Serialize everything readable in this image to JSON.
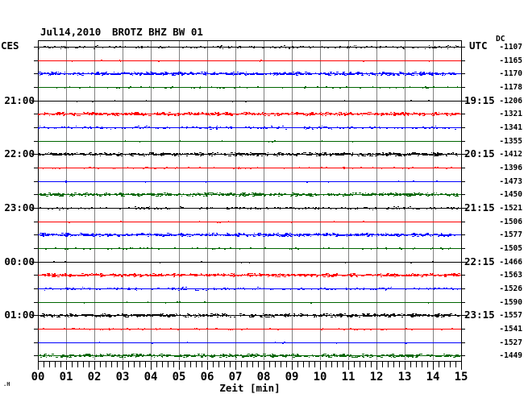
{
  "header": {
    "date": "Jul14,2010",
    "station": "BROTZ BHZ BW 01"
  },
  "watermark": ".H",
  "chart_data": {
    "type": "line",
    "title": "Jul14,2010 BROTZ BHZ BW 01",
    "subtitle": "Helicorder drum plot, 24 rows of 15 minutes each",
    "xlabel": "Zeit [min]",
    "x_min": 0,
    "x_max": 15,
    "x_tick_labels": [
      "00",
      "01",
      "02",
      "03",
      "04",
      "05",
      "06",
      "07",
      "08",
      "09",
      "10",
      "11",
      "12",
      "13",
      "14",
      "15"
    ],
    "x_minor_ticks_per_minute": 5,
    "grid": {
      "vertical_minute_lines": true,
      "horizontal_lines": false
    },
    "legend": "none",
    "rows": 24,
    "row_duration_minutes": 15,
    "trace_color_cycle": [
      "black",
      "red",
      "blue",
      "green"
    ],
    "palette": {
      "black": "#000000",
      "red": "#ff0000",
      "blue": "#0000ff",
      "green": "#006600",
      "grid": "#808080",
      "frame": "#000000"
    },
    "left_axis": {
      "label": "CES",
      "hour_labels": [
        {
          "text": "21:00",
          "row": 4
        },
        {
          "text": "22:00",
          "row": 8
        },
        {
          "text": "23:00",
          "row": 12
        },
        {
          "text": "00:00",
          "row": 16
        },
        {
          "text": "01:00",
          "row": 20
        }
      ]
    },
    "right_axis": {
      "label": "UTC",
      "hour_labels": [
        {
          "text": "19:15",
          "row": 4
        },
        {
          "text": "20:15",
          "row": 8
        },
        {
          "text": "21:15",
          "row": 12
        },
        {
          "text": "22:15",
          "row": 16
        },
        {
          "text": "23:15",
          "row": 20
        }
      ]
    },
    "dc_header": "DC",
    "traces": [
      {
        "row": 1,
        "color": "black",
        "dc": -1107,
        "noise_level": 2
      },
      {
        "row": 2,
        "color": "red",
        "dc": -1165,
        "noise_level": 0
      },
      {
        "row": 3,
        "color": "blue",
        "dc": -1170,
        "noise_level": 3
      },
      {
        "row": 4,
        "color": "green",
        "dc": -1178,
        "noise_level": 1
      },
      {
        "row": 5,
        "color": "black",
        "dc": -1206,
        "noise_level": 0
      },
      {
        "row": 6,
        "color": "red",
        "dc": -1321,
        "noise_level": 3
      },
      {
        "row": 7,
        "color": "blue",
        "dc": -1341,
        "noise_level": 2
      },
      {
        "row": 8,
        "color": "green",
        "dc": -1355,
        "noise_level": 0
      },
      {
        "row": 9,
        "color": "black",
        "dc": -1412,
        "noise_level": 3
      },
      {
        "row": 10,
        "color": "red",
        "dc": -1396,
        "noise_level": 1
      },
      {
        "row": 11,
        "color": "blue",
        "dc": -1473,
        "noise_level": 0
      },
      {
        "row": 12,
        "color": "green",
        "dc": -1450,
        "noise_level": 3
      },
      {
        "row": 13,
        "color": "black",
        "dc": -1521,
        "noise_level": 2
      },
      {
        "row": 14,
        "color": "red",
        "dc": -1506,
        "noise_level": 0
      },
      {
        "row": 15,
        "color": "blue",
        "dc": -1577,
        "noise_level": 3
      },
      {
        "row": 16,
        "color": "green",
        "dc": -1505,
        "noise_level": 1
      },
      {
        "row": 17,
        "color": "black",
        "dc": -1466,
        "noise_level": 0
      },
      {
        "row": 18,
        "color": "red",
        "dc": -1563,
        "noise_level": 3
      },
      {
        "row": 19,
        "color": "blue",
        "dc": -1526,
        "noise_level": 2
      },
      {
        "row": 20,
        "color": "green",
        "dc": -1590,
        "noise_level": 0
      },
      {
        "row": 21,
        "color": "black",
        "dc": -1557,
        "noise_level": 3
      },
      {
        "row": 22,
        "color": "red",
        "dc": -1541,
        "noise_level": 1
      },
      {
        "row": 23,
        "color": "blue",
        "dc": -1527,
        "noise_level": 0
      },
      {
        "row": 24,
        "color": "green",
        "dc": -1449,
        "noise_level": 3
      }
    ]
  }
}
